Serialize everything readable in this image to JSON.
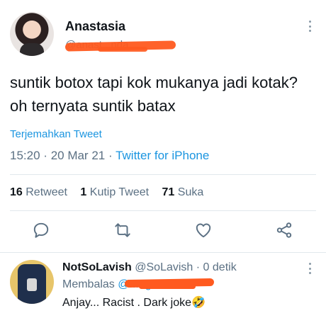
{
  "tweet": {
    "author_name": "Anastasia",
    "handle": "@anast...nda",
    "text": "suntik botox tapi kok mukanya jadi kotak? oh ternyata suntik batax",
    "translate_label": "Terjemahkan Tweet",
    "time": "15:20",
    "date": "20 Mar 21",
    "source": "Twitter for iPhone",
    "sep": "·"
  },
  "stats": {
    "retweets_count": "16",
    "retweets_label": "Retweet",
    "quotes_count": "1",
    "quotes_label": "Kutip Tweet",
    "likes_count": "71",
    "likes_label": "Suka"
  },
  "actions": [
    "reply-icon",
    "retweet-icon",
    "like-icon",
    "share-icon"
  ],
  "reply": {
    "author_name": "NotSoLavish",
    "handle": "@SoLavish",
    "sep": "·",
    "time": "0 detik",
    "replying_label": "Membalas",
    "replying_to": "@...nged",
    "text": "Anjay... Racist . Dark joke🤣"
  },
  "colors": {
    "link": "#1b95e0",
    "muted": "#5b7083",
    "text": "#0f1419",
    "redaction": "#ff5a1f"
  }
}
